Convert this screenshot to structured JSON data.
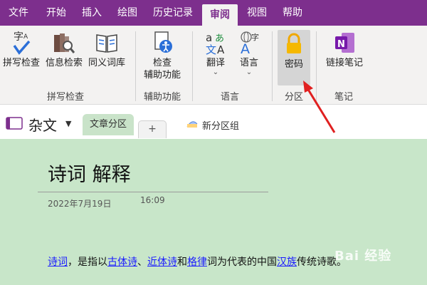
{
  "tabs": [
    "文件",
    "开始",
    "插入",
    "绘图",
    "历史记录",
    "审阅",
    "视图",
    "帮助"
  ],
  "active_tab": "审阅",
  "ribbon": {
    "spelling": "拼写检查",
    "research": "信息检索",
    "thesaurus": "同义词库",
    "group_spelling": "拼写检查",
    "check_line1": "检查",
    "check_line2": "辅助功能",
    "group_accessibility": "辅助功能",
    "translate": "翻译",
    "language": "语言",
    "group_language": "语言",
    "password": "密码",
    "group_section": "分区",
    "linked_notes": "链接笔记",
    "group_notes": "笔记"
  },
  "notebook": {
    "name": "杂文",
    "section": "文章分区",
    "add": "+",
    "new_group": "新分区组"
  },
  "page": {
    "title": "诗词 解释",
    "date": "2022年7月19日",
    "time": "16:09",
    "body": {
      "l1": "诗词",
      "t1": "，是指以",
      "l2": "古体诗",
      "t2": "、",
      "l3": "近体诗",
      "t3": "和",
      "l4": "格律",
      "t4": "词为代表的中国",
      "l5": "汉族",
      "t5": "传统诗歌。"
    }
  },
  "watermark": "Bai 经验",
  "colors": {
    "accent": "#7d2f8d",
    "page_bg": "#c8e6c9",
    "arrow": "#e02020"
  }
}
